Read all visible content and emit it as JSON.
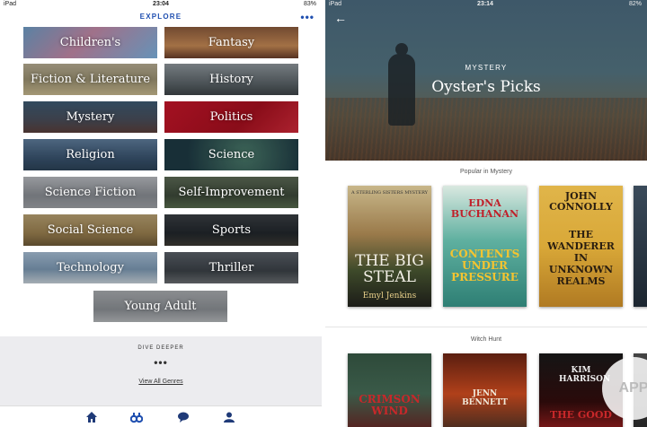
{
  "left": {
    "status": {
      "device": "iPad",
      "time": "23:04",
      "battery": "83%"
    },
    "nav_title": "EXPLORE",
    "more_label": "•••",
    "genres": [
      "Children's",
      "Fantasy",
      "Fiction & Literature",
      "History",
      "Mystery",
      "Politics",
      "Religion",
      "Science",
      "Science Fiction",
      "Self-Improvement",
      "Social Science",
      "Sports",
      "Technology",
      "Thriller",
      "Young Adult"
    ],
    "dive_deeper": {
      "title": "DIVE DEEPER",
      "dots": "•••",
      "link": "View All Genres"
    },
    "tabs": [
      "home-icon",
      "binoculars-icon",
      "chat-icon",
      "profile-icon"
    ],
    "accent": "#1f4fb0"
  },
  "right": {
    "status": {
      "device": "iPad",
      "time": "23:14",
      "battery": "82%"
    },
    "hero": {
      "kicker": "MYSTERY",
      "title": "Oyster's Picks"
    },
    "sections": [
      {
        "title": "Popular in Mystery",
        "books": [
          {
            "title": "THE BIG STEAL",
            "author": "Emyl Jenkins",
            "top": "A STERLING SISTERS MYSTERY"
          },
          {
            "title": "CONTENTS UNDER PRESSURE",
            "author": "EDNA BUCHANAN",
            "top": "EDNA"
          },
          {
            "title": "THE WANDERER IN UNKNOWN REALMS",
            "author": "JOHN CONNOLLY",
            "top": ""
          }
        ]
      },
      {
        "title": "Witch Hunt",
        "books": [
          {
            "title": "CRIMSON WIND",
            "author": "",
            "top": ""
          },
          {
            "title": "",
            "author": "JENN BENNETT",
            "top": ""
          },
          {
            "title": "THE GOOD",
            "author": "KIM HARRISON",
            "top": ""
          }
        ]
      }
    ]
  }
}
